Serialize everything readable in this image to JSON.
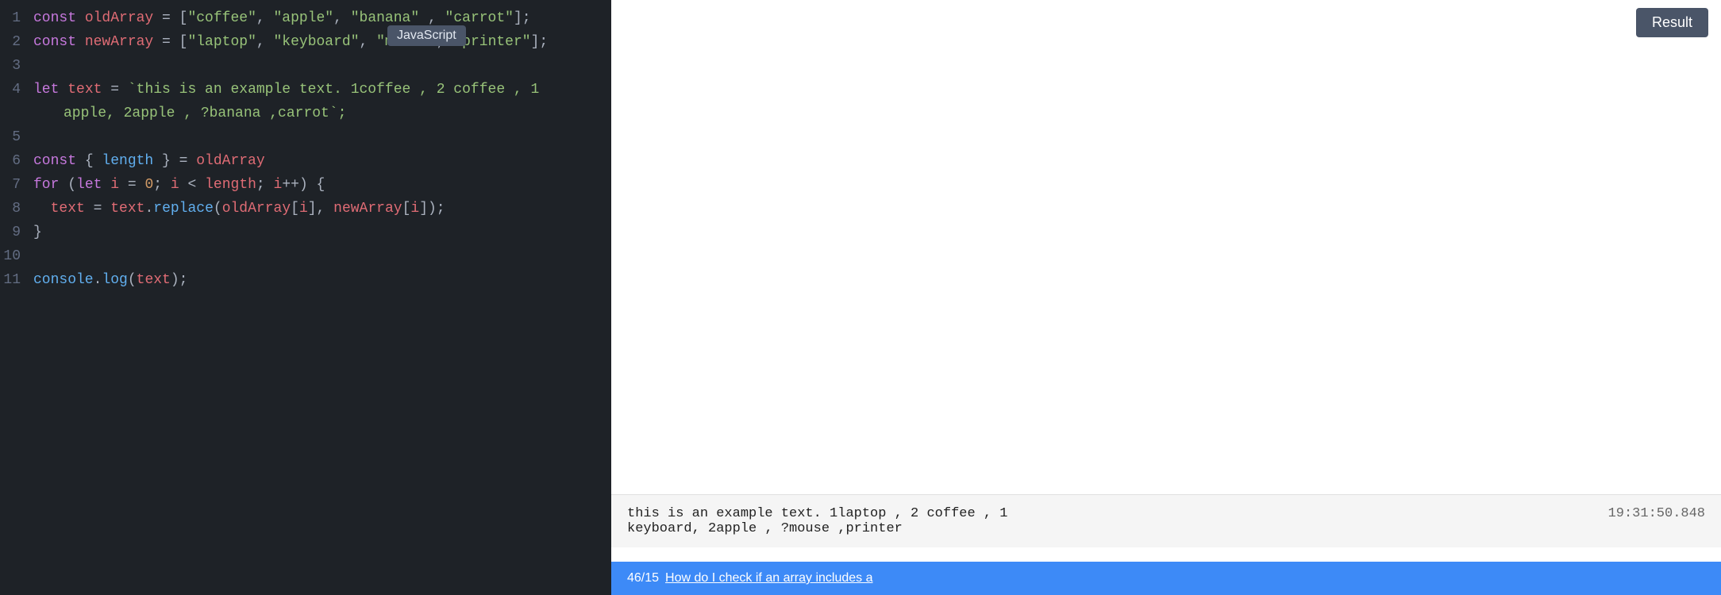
{
  "editor": {
    "language_badge": "JavaScript",
    "lines": [
      {
        "number": "1",
        "tokens": [
          {
            "type": "kw",
            "text": "const "
          },
          {
            "type": "var",
            "text": "oldArray"
          },
          {
            "type": "op",
            "text": " = ["
          },
          {
            "type": "str",
            "text": "\"coffee\""
          },
          {
            "type": "op",
            "text": ", "
          },
          {
            "type": "str",
            "text": "\"apple\""
          },
          {
            "type": "op",
            "text": ", "
          },
          {
            "type": "str",
            "text": "\"banana\""
          },
          {
            "type": "op",
            "text": " , "
          },
          {
            "type": "str",
            "text": "\"carrot\""
          },
          {
            "type": "op",
            "text": "];"
          }
        ]
      },
      {
        "number": "2",
        "tokens": [
          {
            "type": "kw",
            "text": "const "
          },
          {
            "type": "var",
            "text": "newArray"
          },
          {
            "type": "op",
            "text": " = ["
          },
          {
            "type": "str",
            "text": "\"laptop\""
          },
          {
            "type": "op",
            "text": ", "
          },
          {
            "type": "str",
            "text": "\"keyboard\""
          },
          {
            "type": "op",
            "text": ", "
          },
          {
            "type": "str",
            "text": "\"mouse\""
          },
          {
            "type": "op",
            "text": ", "
          },
          {
            "type": "str",
            "text": "\"printer\""
          },
          {
            "type": "op",
            "text": "];"
          }
        ]
      },
      {
        "number": "3",
        "tokens": []
      },
      {
        "number": "4",
        "tokens": [
          {
            "type": "kw",
            "text": "let "
          },
          {
            "type": "var",
            "text": "text"
          },
          {
            "type": "op",
            "text": " = "
          },
          {
            "type": "tmpl",
            "text": "`this is an example text. 1"
          },
          {
            "type": "tmpl-word",
            "text": "coffee"
          },
          {
            "type": "tmpl",
            "text": " , 2 "
          },
          {
            "type": "tmpl",
            "text": "coffee"
          },
          {
            "type": "tmpl",
            "text": " , 1"
          }
        ],
        "continuation": [
          {
            "type": "tmpl",
            "text": "apple, 2"
          },
          {
            "type": "tmpl",
            "text": "apple"
          },
          {
            "type": "tmpl",
            "text": " , ?"
          },
          {
            "type": "tmpl",
            "text": "banana"
          },
          {
            "type": "tmpl",
            "text": " ,"
          },
          {
            "type": "tmpl",
            "text": "carrot"
          },
          {
            "type": "tmpl",
            "text": "`;"
          }
        ]
      },
      {
        "number": "5",
        "tokens": []
      },
      {
        "number": "6",
        "tokens": [
          {
            "type": "kw",
            "text": "const "
          },
          {
            "type": "op",
            "text": "{ "
          },
          {
            "type": "prop",
            "text": "length"
          },
          {
            "type": "op",
            "text": " } = "
          },
          {
            "type": "var",
            "text": "oldArray"
          }
        ]
      },
      {
        "number": "7",
        "tokens": [
          {
            "type": "kw",
            "text": "for "
          },
          {
            "type": "op",
            "text": "("
          },
          {
            "type": "kw",
            "text": "let "
          },
          {
            "type": "var",
            "text": "i"
          },
          {
            "type": "op",
            "text": " = "
          },
          {
            "type": "num",
            "text": "0"
          },
          {
            "type": "op",
            "text": "; "
          },
          {
            "type": "var",
            "text": "i"
          },
          {
            "type": "op",
            "text": " < "
          },
          {
            "type": "var",
            "text": "length"
          },
          {
            "type": "op",
            "text": "; "
          },
          {
            "type": "var",
            "text": "i"
          },
          {
            "type": "op",
            "text": "++) {"
          }
        ]
      },
      {
        "number": "8",
        "tokens": [
          {
            "type": "op",
            "text": "  "
          },
          {
            "type": "var",
            "text": "text"
          },
          {
            "type": "op",
            "text": " = "
          },
          {
            "type": "var",
            "text": "text"
          },
          {
            "type": "op",
            "text": "."
          },
          {
            "type": "fn",
            "text": "replace"
          },
          {
            "type": "op",
            "text": "("
          },
          {
            "type": "var",
            "text": "oldArray"
          },
          {
            "type": "op",
            "text": "["
          },
          {
            "type": "var",
            "text": "i"
          },
          {
            "type": "op",
            "text": "], "
          },
          {
            "type": "var",
            "text": "newArray"
          },
          {
            "type": "op",
            "text": "["
          },
          {
            "type": "var",
            "text": "i"
          },
          {
            "type": "op",
            "text": "]);"
          }
        ]
      },
      {
        "number": "9",
        "tokens": [
          {
            "type": "op",
            "text": "}"
          }
        ]
      },
      {
        "number": "10",
        "tokens": []
      },
      {
        "number": "11",
        "tokens": [
          {
            "type": "fn",
            "text": "console"
          },
          {
            "type": "op",
            "text": "."
          },
          {
            "type": "fn",
            "text": "log"
          },
          {
            "type": "op",
            "text": "("
          },
          {
            "type": "var",
            "text": "text"
          },
          {
            "type": "op",
            "text": ");"
          }
        ]
      }
    ]
  },
  "result_panel": {
    "button_label": "Result",
    "console": {
      "output_line1": "this is an example text. 1laptop , 2 coffee , 1",
      "output_line2": "keyboard, 2apple , ?mouse ,printer",
      "timestamp": "19:31:50.848"
    },
    "bottom_bar": {
      "position": "46",
      "total": "15",
      "link_text": "How do I check if an array includes a"
    }
  }
}
